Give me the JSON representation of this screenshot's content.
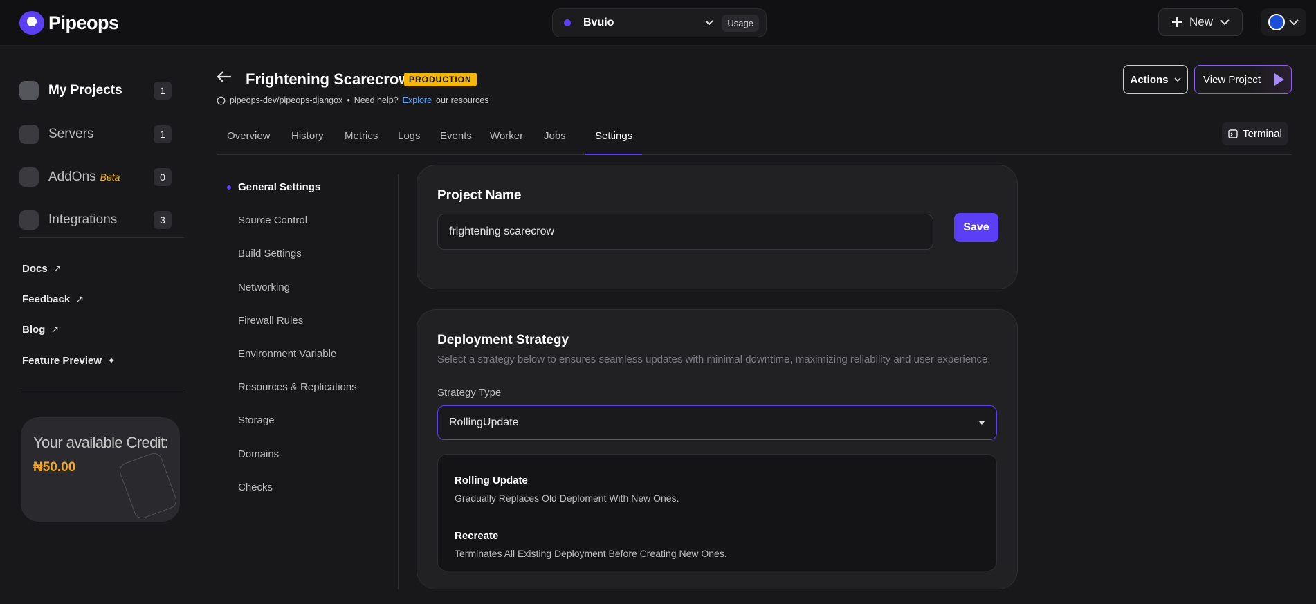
{
  "app": {
    "name": "Pipeops"
  },
  "topbar": {
    "workspace": "Bvuio",
    "usage_label": "Usage",
    "new_label": "New"
  },
  "sidebar": {
    "items": [
      {
        "label": "My Projects",
        "count": "1"
      },
      {
        "label": "Servers",
        "count": "1"
      },
      {
        "label": "AddOns",
        "badge": "Beta",
        "count": "0"
      },
      {
        "label": "Integrations",
        "count": "3"
      }
    ],
    "links": [
      "Docs",
      "Feedback",
      "Blog",
      "Feature Preview"
    ],
    "credit": {
      "title": "Your available Credit:",
      "amount": "₦50.00"
    }
  },
  "project": {
    "title": "Frightening Scarecrow",
    "env_badge": "PRODUCTION",
    "repo": "pipeops-dev/pipeops-djangox",
    "help_prefix": "Need help?",
    "help_link": "Explore",
    "help_suffix": "our resources"
  },
  "header_actions": {
    "actions_label": "Actions",
    "view_label": "View Project",
    "terminal_label": "Terminal"
  },
  "tabs": [
    "Overview",
    "History",
    "Metrics",
    "Logs",
    "Events",
    "Worker",
    "Jobs",
    "Settings"
  ],
  "settings_nav": [
    "General Settings",
    "Source Control",
    "Build Settings",
    "Networking",
    "Firewall Rules",
    "Environment Variable",
    "Resources & Replications",
    "Storage",
    "Domains",
    "Checks"
  ],
  "project_name_card": {
    "title": "Project Name",
    "value": "frightening scarecrow",
    "save_label": "Save"
  },
  "deploy_card": {
    "title": "Deployment Strategy",
    "description": "Select a strategy below to ensures seamless updates with minimal downtime, maximizing reliability and user experience.",
    "strategy_label": "Strategy Type",
    "selected": "RollingUpdate",
    "options": [
      {
        "title": "Rolling Update",
        "desc": "Gradually Replaces Old Deploment With New Ones."
      },
      {
        "title": "Recreate",
        "desc": "Terminates All Existing Deployment Before Creating New Ones."
      }
    ]
  },
  "colors": {
    "accent": "#5b3ff5",
    "badge": "#f5b700",
    "credit": "#f5a623"
  }
}
